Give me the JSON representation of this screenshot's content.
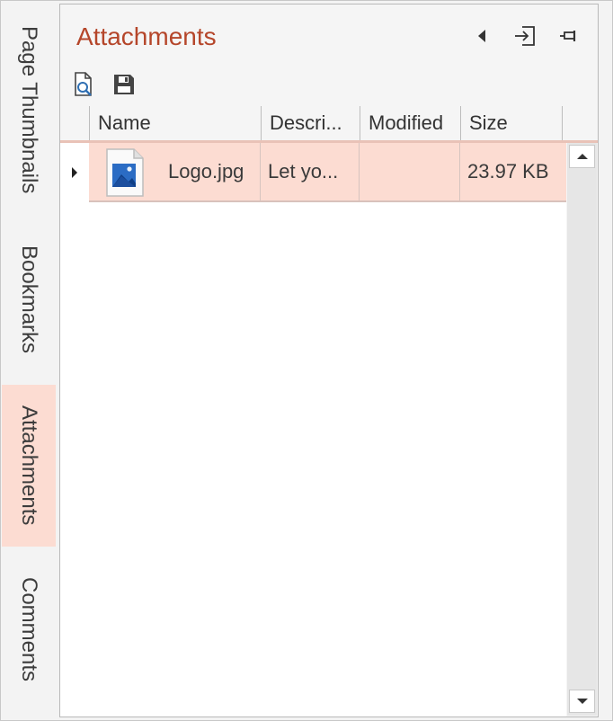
{
  "side_tabs": [
    {
      "label": "Page Thumbnails"
    },
    {
      "label": "Bookmarks"
    },
    {
      "label": "Attachments"
    },
    {
      "label": "Comments"
    }
  ],
  "panel": {
    "title": "Attachments"
  },
  "grid": {
    "columns": [
      "Name",
      "Descri...",
      "Modified",
      "Size"
    ],
    "rows": [
      {
        "name": "Logo.jpg",
        "description": "Let yo...",
        "modified": "",
        "size": "23.97 KB",
        "icon": "image-file-icon"
      }
    ]
  },
  "colors": {
    "accent": "#b5462a",
    "selection": "#fcdcd2"
  }
}
